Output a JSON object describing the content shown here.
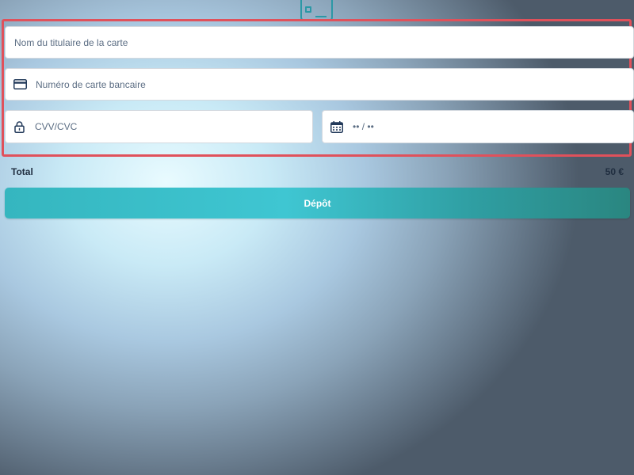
{
  "form": {
    "holder_placeholder": "Nom du titulaire de la carte",
    "number_placeholder": "Numéro de carte bancaire",
    "cvv_placeholder": "CVV/CVC",
    "expiry_placeholder": "•• / ••",
    "icons": {
      "top": "credit-card-icon",
      "number": "credit-card-icon",
      "cvv": "lock-icon",
      "expiry": "calendar-icon"
    }
  },
  "summary": {
    "total_label": "Total",
    "total_value": "50 €"
  },
  "actions": {
    "deposit_label": "Dépôt"
  },
  "colors": {
    "accent": "#2c98a6",
    "highlight_border": "#e0515b",
    "button_gradient": [
      "#35b6bf",
      "#2a8680"
    ],
    "text": "#5c6e84"
  }
}
